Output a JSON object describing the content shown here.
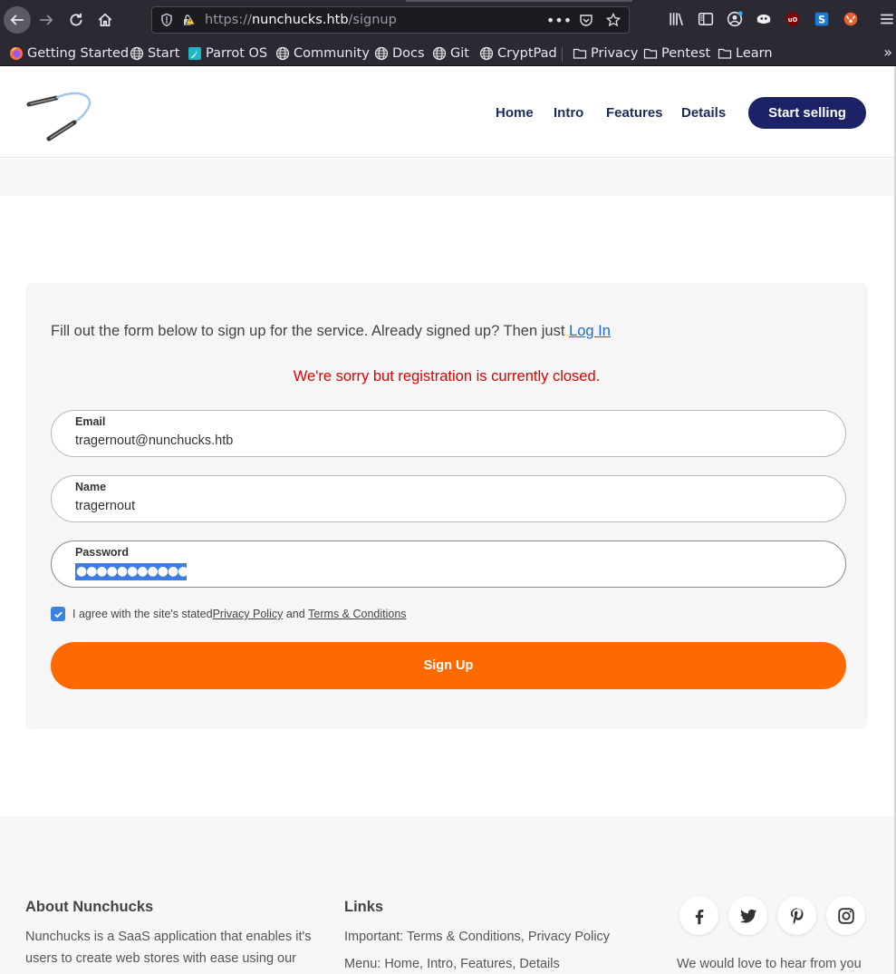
{
  "browser": {
    "url_scheme": "https://",
    "url_host": "nunchucks.htb",
    "url_path": "/signup",
    "bookmarks": [
      {
        "label": "Getting Started",
        "icon": "firefox-icon"
      },
      {
        "label": "Start",
        "icon": "globe-icon"
      },
      {
        "label": "Parrot OS",
        "icon": "parrot-icon"
      },
      {
        "label": "Community",
        "icon": "globe-icon"
      },
      {
        "label": "Docs",
        "icon": "globe-icon"
      },
      {
        "label": "Git",
        "icon": "globe-icon"
      },
      {
        "label": "CryptPad",
        "icon": "globe-icon"
      },
      {
        "label": "Privacy",
        "icon": "folder-icon"
      },
      {
        "label": "Pentest",
        "icon": "folder-icon"
      },
      {
        "label": "Learn",
        "icon": "folder-icon"
      }
    ],
    "overflow": "»"
  },
  "header": {
    "nav": [
      "Home",
      "Intro",
      "Features",
      "Details"
    ],
    "cta": "Start selling"
  },
  "form": {
    "intro_text": "Fill out the form below to sign up for the service. Already signed up? Then just ",
    "login_link": "Log In",
    "error": "We're sorry but registration is currently closed.",
    "email_label": "Email",
    "email_value": "tragernout@nunchucks.htb",
    "name_label": "Name",
    "name_value": "tragernout",
    "password_label": "Password",
    "password_mask": "●●●●●●●●●●●",
    "agree_prefix": "I agree with the site's stated ",
    "privacy_link": "Privacy Policy",
    "agree_and": " and ",
    "terms_link": "Terms & Conditions",
    "agree_checked": true,
    "submit": "Sign Up"
  },
  "footer": {
    "about_title": "About Nunchucks",
    "about_line1": "Nunchucks is a SaaS application that enables it's",
    "about_line2": "users to create web stores with ease using our",
    "links_title": "Links",
    "links_line1": "Important: Terms & Conditions, Privacy Policy",
    "links_line2": "Menu: Home, Intro, Features, Details",
    "contact_line": "We would love to hear from you"
  },
  "colors": {
    "brand_navy": "#1c2266",
    "accent_orange": "#ff6a00",
    "error_red": "#e00000",
    "link_blue": "#1f6ad6"
  }
}
